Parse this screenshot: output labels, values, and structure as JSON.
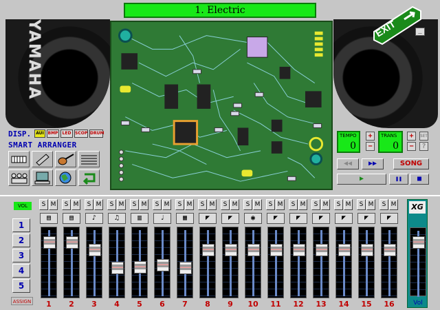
{
  "title": "1. Electric",
  "brand": "YAMAHA",
  "exit": {
    "label": "EXIT",
    "close_label": "_"
  },
  "arranger": {
    "disp_label": "DISP.",
    "disp_modes": [
      "AUI",
      "BMP",
      "LED",
      "SCOP",
      "DRUM"
    ],
    "active_mode": "AUI",
    "title": "SMART ARRANGER",
    "icons": [
      "keyboard-icon",
      "tools-icon",
      "guitar-icon",
      "score-icon",
      "band-icon",
      "computer-icon",
      "globe-icon",
      "loop-icon"
    ]
  },
  "transport": {
    "tempo_label": "TEMPO",
    "tempo_value": "0",
    "trans_label": "TRANS",
    "trans_value": "0",
    "plus": "+",
    "minus": "−",
    "set_label": "SET",
    "help_label": "?",
    "rewind": "◀◀",
    "forward": "▶▶",
    "song_label": "SONG",
    "play": "▶",
    "pause": "❚❚",
    "stop": "■"
  },
  "mixer": {
    "vol_label": "VOL",
    "groups": [
      "1",
      "2",
      "3",
      "4",
      "5"
    ],
    "assign_label": "ASSIGN",
    "solo": "S",
    "mute": "M",
    "channels": [
      {
        "num": "1",
        "icon": "piano-icon",
        "glyph": "▤",
        "level": 0.85
      },
      {
        "num": "2",
        "icon": "piano-icon",
        "glyph": "▤",
        "level": 0.85
      },
      {
        "num": "3",
        "icon": "guitar-icon",
        "glyph": "♪",
        "level": 0.72
      },
      {
        "num": "4",
        "icon": "bass-icon",
        "glyph": "♫",
        "level": 0.4
      },
      {
        "num": "5",
        "icon": "strings-icon",
        "glyph": "▥",
        "level": 0.42
      },
      {
        "num": "6",
        "icon": "brass-icon",
        "glyph": "♩",
        "level": 0.45
      },
      {
        "num": "7",
        "icon": "organ-icon",
        "glyph": "▦",
        "level": 0.4
      },
      {
        "num": "8",
        "icon": "gun-icon",
        "glyph": "◤",
        "level": 0.72
      },
      {
        "num": "9",
        "icon": "gun-icon",
        "glyph": "◤",
        "level": 0.72
      },
      {
        "num": "10",
        "icon": "drum-icon",
        "glyph": "◉",
        "level": 0.72
      },
      {
        "num": "11",
        "icon": "gun-icon",
        "glyph": "◤",
        "level": 0.72
      },
      {
        "num": "12",
        "icon": "gun-icon",
        "glyph": "◤",
        "level": 0.72
      },
      {
        "num": "13",
        "icon": "gun-icon",
        "glyph": "◤",
        "level": 0.72
      },
      {
        "num": "14",
        "icon": "gun-icon",
        "glyph": "◤",
        "level": 0.72
      },
      {
        "num": "15",
        "icon": "gun-icon",
        "glyph": "◤",
        "level": 0.72
      },
      {
        "num": "16",
        "icon": "gun-icon",
        "glyph": "◤",
        "level": 0.72
      }
    ],
    "master_logo": "XG",
    "master_label": "Vol",
    "master_level": 0.85
  },
  "colors": {
    "lcd": "#18e818",
    "board": "#2f7a35",
    "accent_red": "#c00000",
    "accent_blue": "#0000b0"
  }
}
